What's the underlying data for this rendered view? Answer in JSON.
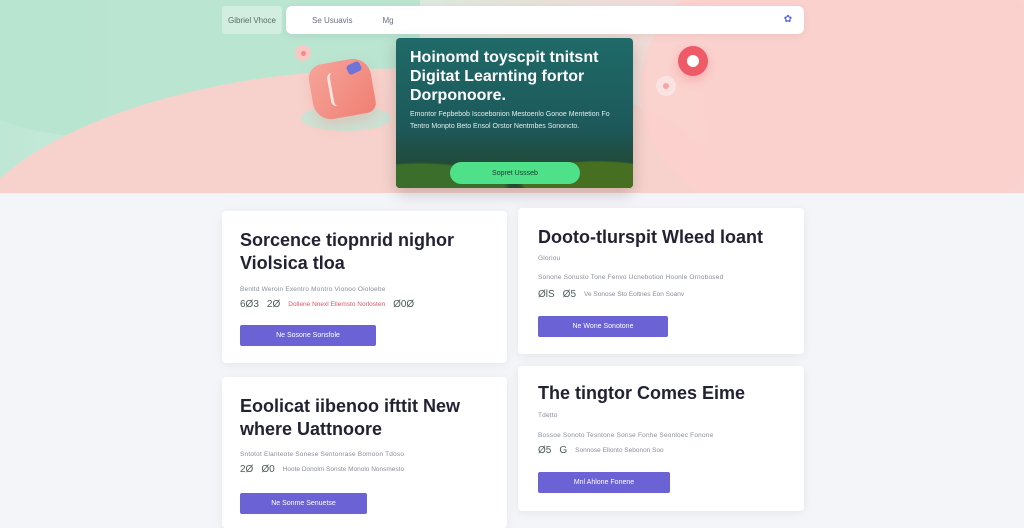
{
  "nav": {
    "brand": "Gibriel Vhoce",
    "links": [
      "Se Usuavis",
      "Mg"
    ],
    "icon": "settings-icon"
  },
  "hero": {
    "title": "Hoinomd toyscpit tnitsnt Digitat Learnting fortor Dorponoore.",
    "description": "Emontor Fepbebob Iscoebonion Mestoenlo Gonoe Mentetion Fo Tentro Monpto Beto Ensol Orstor Nentmbes Sononcto.",
    "cta": "Sopret Ussseb"
  },
  "cards": [
    {
      "title": "Sorcence tiopnrid nighor Violsica tloa",
      "meta": "Benltd Weroin Exentro Montro Vionoo Oioloebe",
      "stats": [
        "6Ø3",
        "2Ø",
        "Dollene Nnexl Ellemsto Norlosten",
        "Ø0Ø"
      ],
      "button": "Ne Sosone Sonsfole"
    },
    {
      "title": "Dooto-tlurspit Wleed loant",
      "meta": "Gloriou",
      "meta2": "Sonone Sonusto Tone Fenvo Ucnebotion Hoonle Ornobosed",
      "stats": [
        "ØlS",
        "Ø5",
        "Ve Sonose Sto Eoltnes Eon Soanv"
      ],
      "button": "Ne Wone Sonotone"
    },
    {
      "title": "Eoolicat iibenoo ifttit New where Uattnoore",
      "meta": "Sntotot Elanteote Sonese Sentonrase Bomoon Tdoso",
      "stats": [
        "2Ø",
        "Ø0",
        "Hoote Donolm Sonste Monolo Nonsmesto"
      ],
      "button": "Ne Sonme Senuetse"
    },
    {
      "title": "The tingtor Comes Eime",
      "meta": "Tdetto",
      "meta2": "Bossoe Sonoto Tesntone Sonse Fonhe Seonloec Fonone",
      "stats": [
        "Ø5",
        "G",
        "Sonnose Ellonto Sebonon Soo"
      ],
      "button": "Mnl Ahlone Fonene"
    }
  ]
}
